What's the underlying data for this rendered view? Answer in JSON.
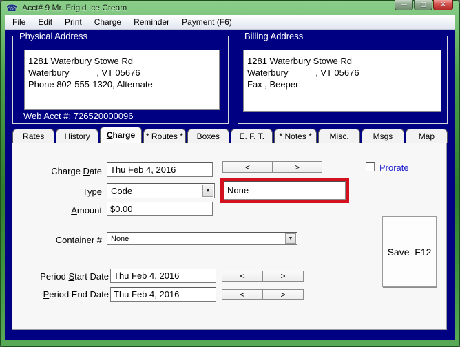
{
  "window": {
    "title": "Acct# 9 Mr. Frigid Ice Cream",
    "controls": {
      "minimize": "—",
      "maximize": "▢",
      "close": "✕"
    }
  },
  "icons": {
    "app": "☎",
    "dropdown": "▼"
  },
  "menu": {
    "items": [
      "File",
      "Edit",
      "Print",
      "Charge",
      "Reminder",
      "Payment (F6)"
    ]
  },
  "physical_address": {
    "title": "Physical Address",
    "lines": [
      "1281 Waterbury Stowe Rd",
      "Waterbury           , VT 05676",
      "Phone 802-555-1320, Alternate"
    ],
    "web_acct": "Web Acct #: 726520000096"
  },
  "billing_address": {
    "title": "Billing Address",
    "lines": [
      "1281 Waterbury Stowe Rd",
      "Waterbury           , VT 05676",
      "Fax , Beeper"
    ]
  },
  "tabs": [
    {
      "pre": "",
      "key": "R",
      "post": "ates"
    },
    {
      "pre": "",
      "key": "H",
      "post": "istory"
    },
    {
      "pre": "",
      "key": "C",
      "post": "harge"
    },
    {
      "pre": "* R",
      "key": "o",
      "post": "utes *"
    },
    {
      "pre": "",
      "key": "B",
      "post": "oxes"
    },
    {
      "pre": "",
      "key": "E",
      "post": ". F. T."
    },
    {
      "pre": "* ",
      "key": "N",
      "post": "otes *"
    },
    {
      "pre": "",
      "key": "M",
      "post": "isc."
    },
    {
      "pre": "",
      "key": "",
      "post": "Msgs"
    },
    {
      "pre": "",
      "key": "",
      "post": "Map"
    }
  ],
  "form": {
    "nav": {
      "prev": "<",
      "next": ">"
    },
    "charge_date": {
      "label": {
        "pre": "Charge ",
        "key": "D",
        "post": "ate"
      },
      "value": "Thu Feb 4, 2016"
    },
    "prorate": {
      "label": "Prorate",
      "checked": false
    },
    "type": {
      "label": {
        "pre": "",
        "key": "T",
        "post": "ype"
      },
      "value": "Code"
    },
    "type_code": {
      "value": "None"
    },
    "amount": {
      "label": {
        "pre": "",
        "key": "A",
        "post": "mount"
      },
      "value": "$0.00"
    },
    "container": {
      "label": {
        "pre": "Container ",
        "key": "#",
        "post": ""
      },
      "value": "None"
    },
    "save": {
      "label": "Save  F12"
    },
    "period_start": {
      "label": {
        "pre": "Period ",
        "key": "S",
        "post": "tart Date"
      },
      "value": "Thu Feb 4, 2016"
    },
    "period_end": {
      "label": {
        "pre": "",
        "key": "P",
        "post": "eriod End Date"
      },
      "value": "Thu Feb 4, 2016"
    }
  },
  "colors": {
    "titlebar_green": "#3c8f3c",
    "navy": "#000083",
    "highlight_red": "#d2121f",
    "prorate_blue": "#2323cc"
  }
}
